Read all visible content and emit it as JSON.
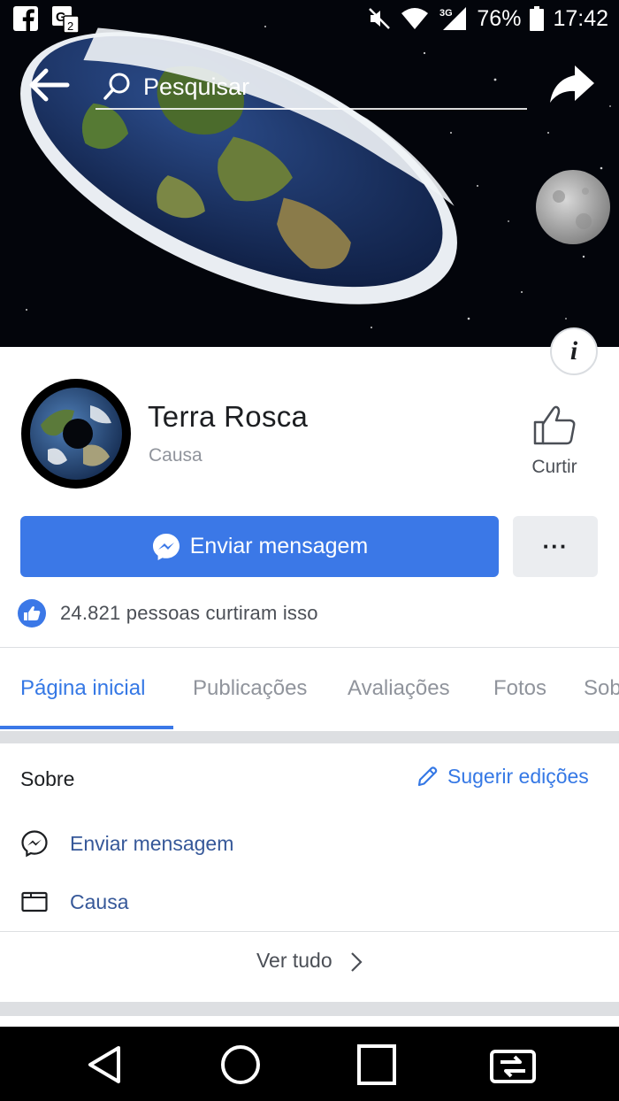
{
  "status_bar": {
    "battery": "76%",
    "time": "17:42",
    "network": "3G",
    "icons": [
      "facebook-notification-icon",
      "translate-notification-icon",
      "mute-icon",
      "wifi-icon",
      "signal-icon",
      "battery-icon"
    ]
  },
  "search": {
    "placeholder": "Pesquisar"
  },
  "page": {
    "name": "Terra Rosca",
    "category": "Causa",
    "like_label": "Curtir",
    "message_button": "Enviar mensagem",
    "more_button": "···",
    "likes_count": "24.821",
    "likes_text": "24.821 pessoas curtiram isso"
  },
  "tabs": [
    {
      "label": "Página inicial",
      "active": true
    },
    {
      "label": "Publicações",
      "active": false
    },
    {
      "label": "Avaliações",
      "active": false
    },
    {
      "label": "Fotos",
      "active": false
    },
    {
      "label": "Sob",
      "active": false
    }
  ],
  "about": {
    "title": "Sobre",
    "suggest_edits": "Sugerir edições",
    "rows": [
      {
        "icon": "messenger-icon",
        "label": "Enviar mensagem"
      },
      {
        "icon": "category-icon",
        "label": "Causa"
      }
    ],
    "see_all": "Ver tudo"
  },
  "colors": {
    "accent": "#3b78e7",
    "link": "#365899",
    "muted": "#90949c",
    "divider": "#dddfe2"
  }
}
